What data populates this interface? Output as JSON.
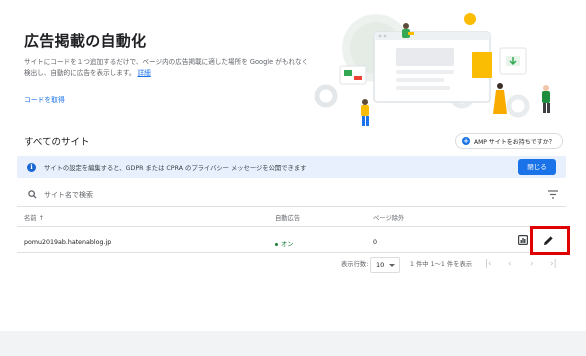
{
  "header": {
    "title": "広告掲載の自動化",
    "description": "サイトにコードを１つ追加するだけで、ページ内の広告掲載に適した場所を Google がもれなく検出し、自動的に広告を表示します。",
    "details_link": "詳細",
    "get_code_link": "コードを取得"
  },
  "sites": {
    "section_title": "すべてのサイト",
    "amp_button": "AMP サイトをお持ちですか？"
  },
  "banner": {
    "message": "サイトの設定を編集すると、GDPR または CPRA のプライバシー メッセージを公開できます",
    "close_label": "閉じる"
  },
  "search": {
    "placeholder": "サイト名で検索"
  },
  "table": {
    "headers": {
      "name": "名前 ↑",
      "auto_ads": "自動広告",
      "page_exclusions": "ページ除外"
    },
    "rows": [
      {
        "name": "pomu2019ab.hatenablog.jp",
        "auto_ads": "オン",
        "page_exclusions": "0"
      }
    ]
  },
  "pagination": {
    "rows_label": "表示行数:",
    "rows_value": "10",
    "range_text": "1 件中 1～1 件を表示"
  },
  "colors": {
    "accent": "#1a73e8",
    "banner_bg": "#e8f0fe",
    "status_on": "#188038",
    "highlight": "#e00000"
  }
}
